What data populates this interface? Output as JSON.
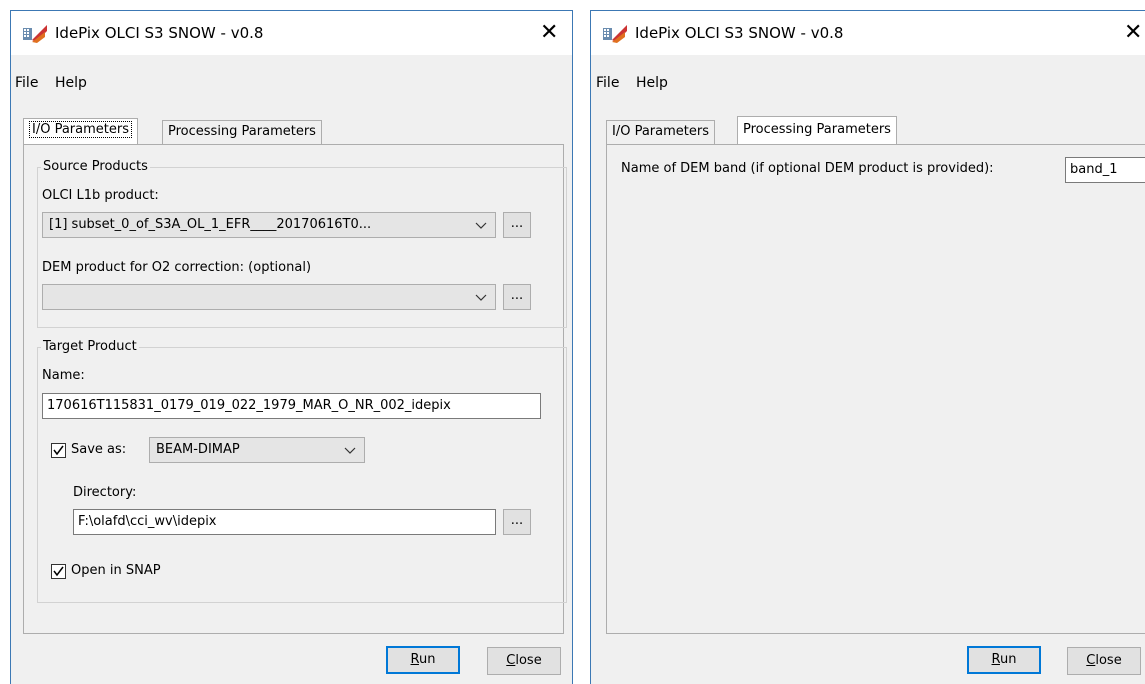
{
  "left_window": {
    "title": "IdePix OLCI S3 SNOW - v0.8",
    "menu": {
      "file": "File",
      "help": "Help"
    },
    "tabs": {
      "io": "I/O Parameters",
      "processing": "Processing Parameters"
    },
    "source_products": {
      "legend": "Source Products",
      "olci_label": "OLCI L1b product:",
      "olci_value": "[1] subset_0_of_S3A_OL_1_EFR____20170616T0...",
      "dem_label": "DEM product for O2 correction: (optional)",
      "dem_value": "",
      "browse": "..."
    },
    "target_product": {
      "legend": "Target Product",
      "name_label": "Name:",
      "name_value": "170616T115831_0179_019_022_1979_MAR_O_NR_002_idepix",
      "save_as_label": "Save as:",
      "save_as_checked": true,
      "format_value": "BEAM-DIMAP",
      "directory_label": "Directory:",
      "directory_value": "F:\\olafd\\cci_wv\\idepix",
      "browse": "...",
      "open_in_snap_label": "Open in SNAP",
      "open_in_snap_checked": true
    },
    "buttons": {
      "run": "Run",
      "close": "Close"
    }
  },
  "right_window": {
    "title": "IdePix OLCI S3 SNOW - v0.8",
    "menu": {
      "file": "File",
      "help": "Help"
    },
    "tabs": {
      "io": "I/O Parameters",
      "processing": "Processing Parameters"
    },
    "dem_band_label": "Name of DEM band (if optional DEM product is provided):",
    "dem_band_value": "band_1",
    "buttons": {
      "run": "Run",
      "close": "Close"
    }
  },
  "colors": {
    "accent": "#0078d7",
    "window_border": "#3c78b4",
    "panel_bg": "#f0f0f0"
  }
}
